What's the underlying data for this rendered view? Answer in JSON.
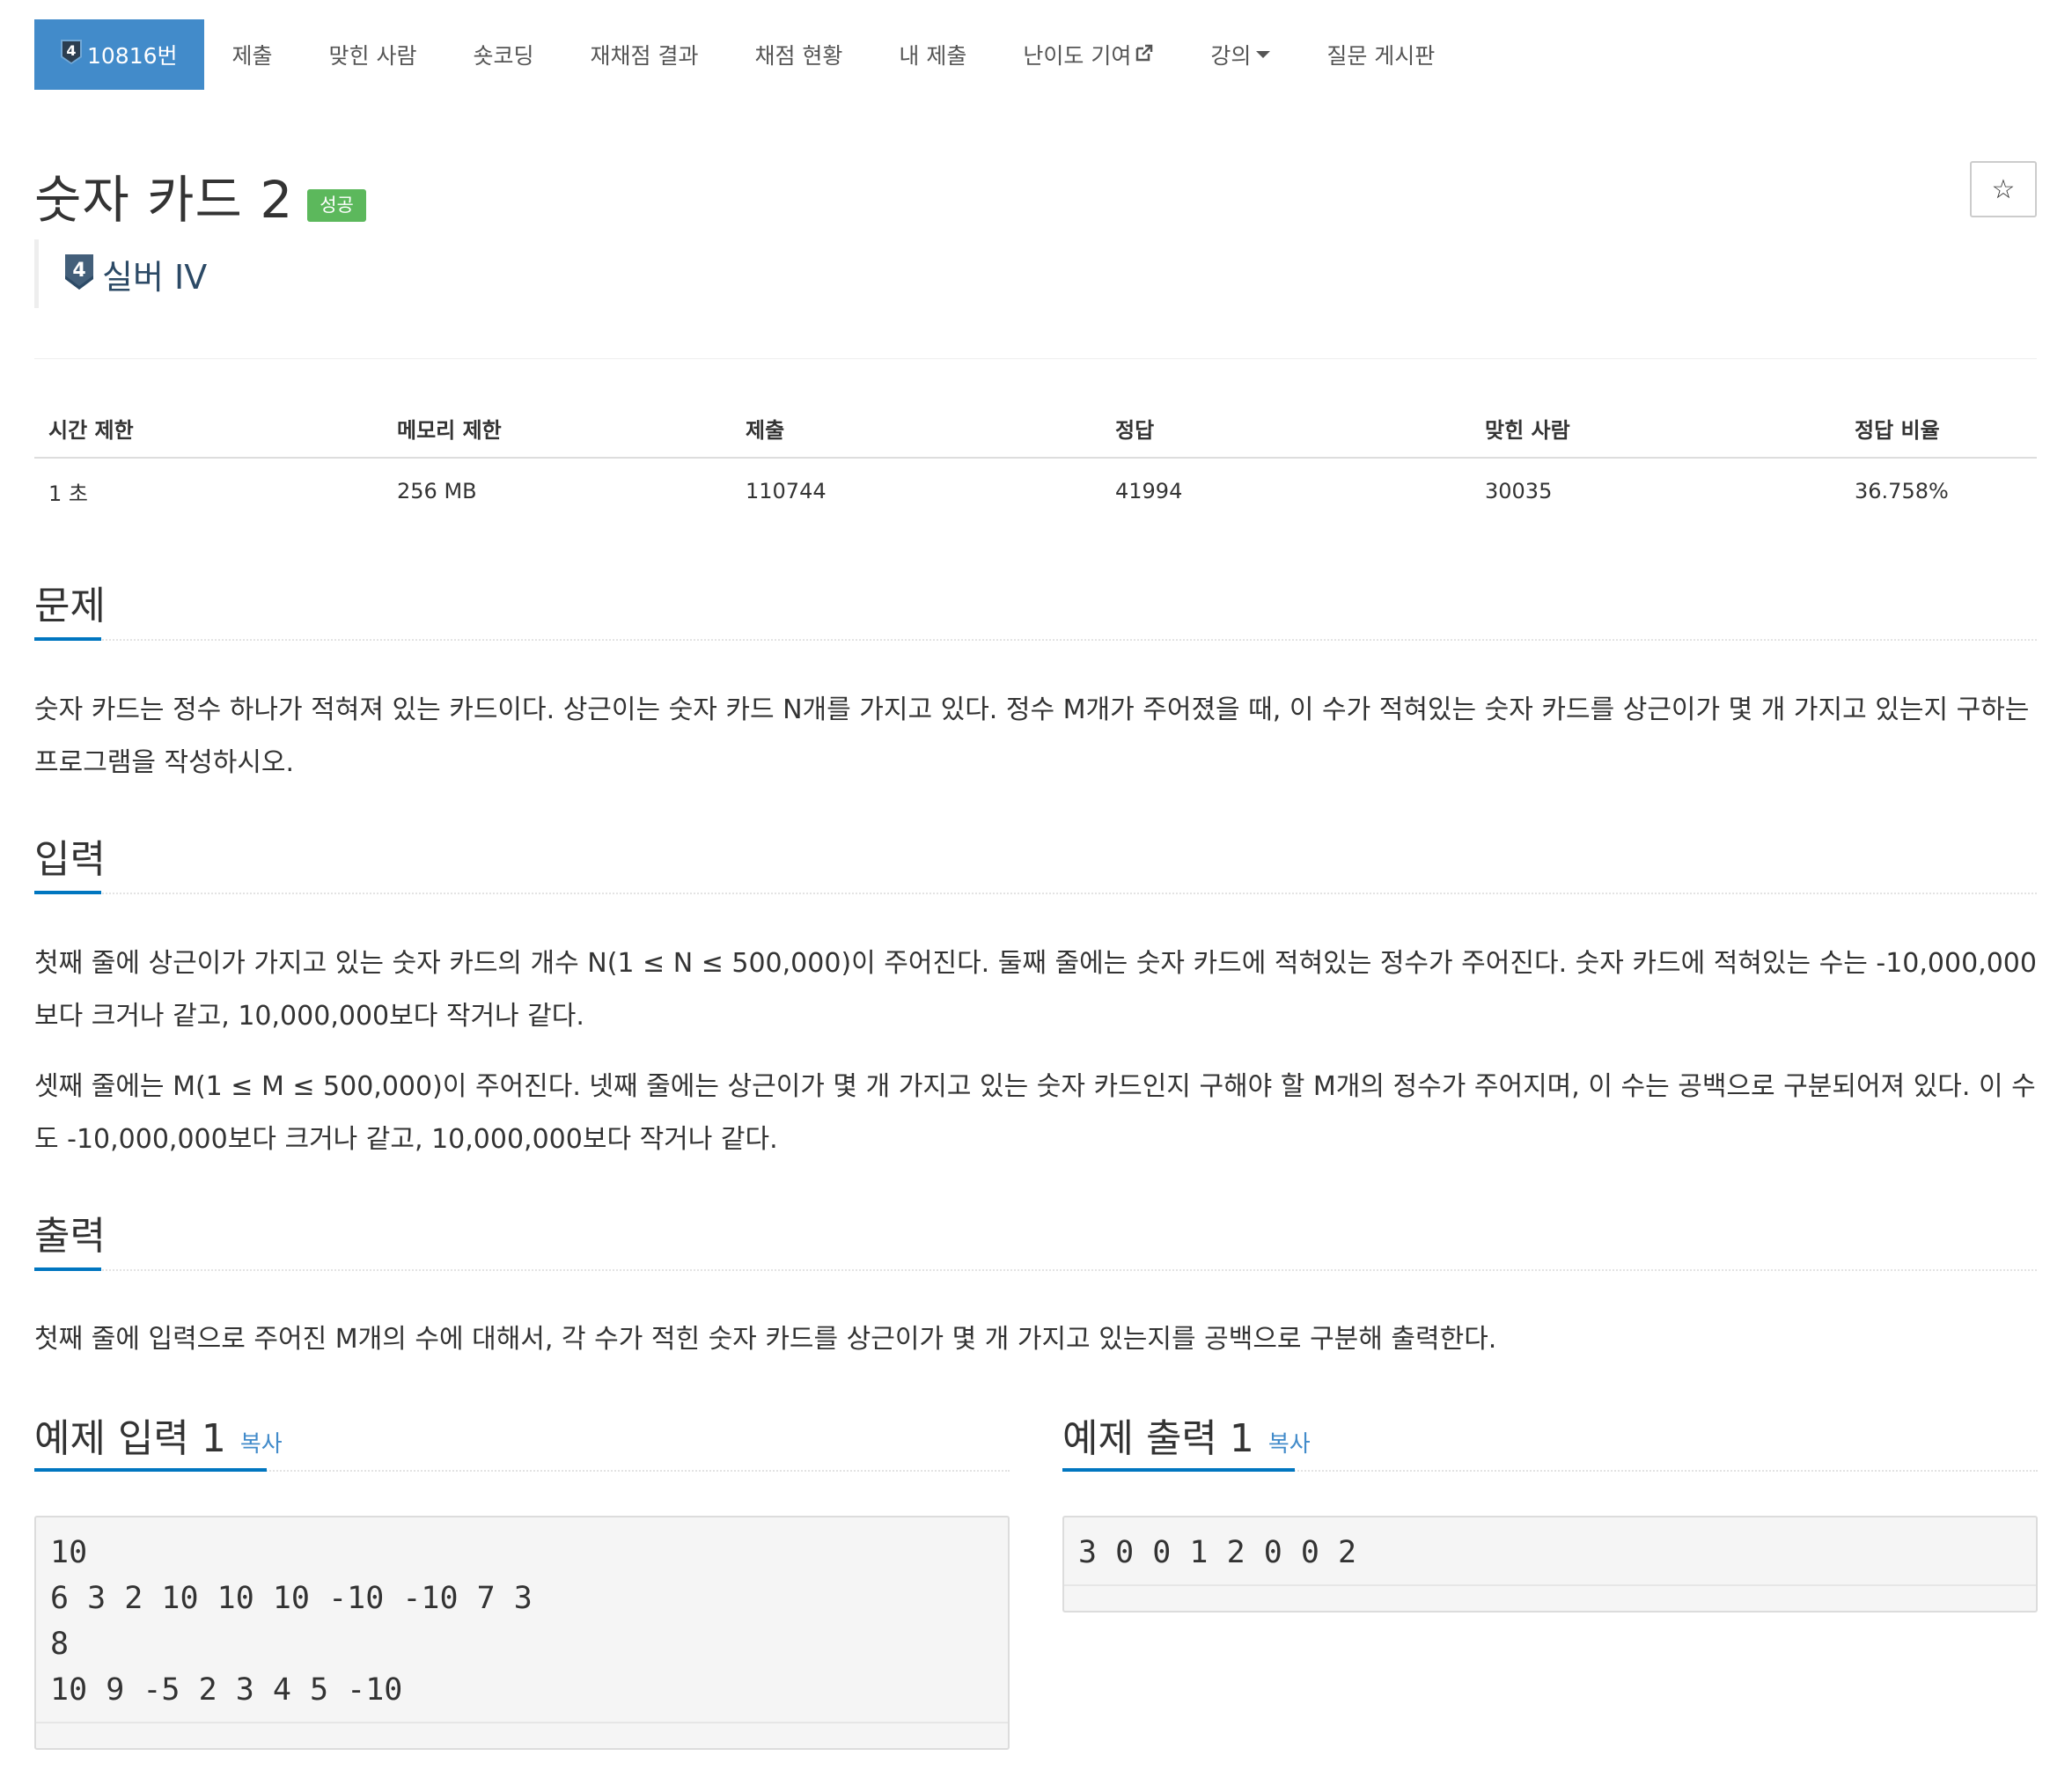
{
  "nav": {
    "problem_tier": "4",
    "problem_number": "10816번",
    "items": [
      "제출",
      "맞힌 사람",
      "숏코딩",
      "재채점 결과",
      "채점 현황",
      "내 제출",
      "난이도 기여",
      "강의",
      "질문 게시판"
    ]
  },
  "title": "숫자 카드 2",
  "status_badge": "성공",
  "star_icon": "☆",
  "tier": {
    "number": "4",
    "label": "실버 IV",
    "color": "#435f7a"
  },
  "stats": {
    "headers": [
      "시간 제한",
      "메모리 제한",
      "제출",
      "정답",
      "맞힌 사람",
      "정답 비율"
    ],
    "values": [
      "1 초",
      "256 MB",
      "110744",
      "41994",
      "30035",
      "36.758%"
    ]
  },
  "sections": {
    "problem": {
      "heading": "문제",
      "text": "숫자 카드는 정수 하나가 적혀져 있는 카드이다. 상근이는 숫자 카드 N개를 가지고 있다. 정수 M개가 주어졌을 때, 이 수가 적혀있는 숫자 카드를 상근이가 몇 개 가지고 있는지 구하는 프로그램을 작성하시오."
    },
    "input": {
      "heading": "입력",
      "p1": "첫째 줄에 상근이가 가지고 있는 숫자 카드의 개수 N(1 ≤ N ≤ 500,000)이 주어진다. 둘째 줄에는 숫자 카드에 적혀있는 정수가 주어진다. 숫자 카드에 적혀있는 수는 -10,000,000보다 크거나 같고, 10,000,000보다 작거나 같다.",
      "p2": "셋째 줄에는 M(1 ≤ M ≤ 500,000)이 주어진다. 넷째 줄에는 상근이가 몇 개 가지고 있는 숫자 카드인지 구해야 할 M개의 정수가 주어지며, 이 수는 공백으로 구분되어져 있다. 이 수도 -10,000,000보다 크거나 같고, 10,000,000보다 작거나 같다."
    },
    "output": {
      "heading": "출력",
      "text": "첫째 줄에 입력으로 주어진 M개의 수에 대해서, 각 수가 적힌 숫자 카드를 상근이가 몇 개 가지고 있는지를 공백으로 구분해 출력한다."
    }
  },
  "samples": {
    "input_heading": "예제 입력 1",
    "output_heading": "예제 출력 1",
    "copy_label": "복사",
    "input": "10\n6 3 2 10 10 10 -10 -10 7 3\n8\n10 9 -5 2 3 4 5 -10",
    "output": "3 0 0 1 2 0 0 2"
  },
  "colors": {
    "primary": "#428bca",
    "success": "#5cb85c",
    "accent": "#0076c0"
  }
}
